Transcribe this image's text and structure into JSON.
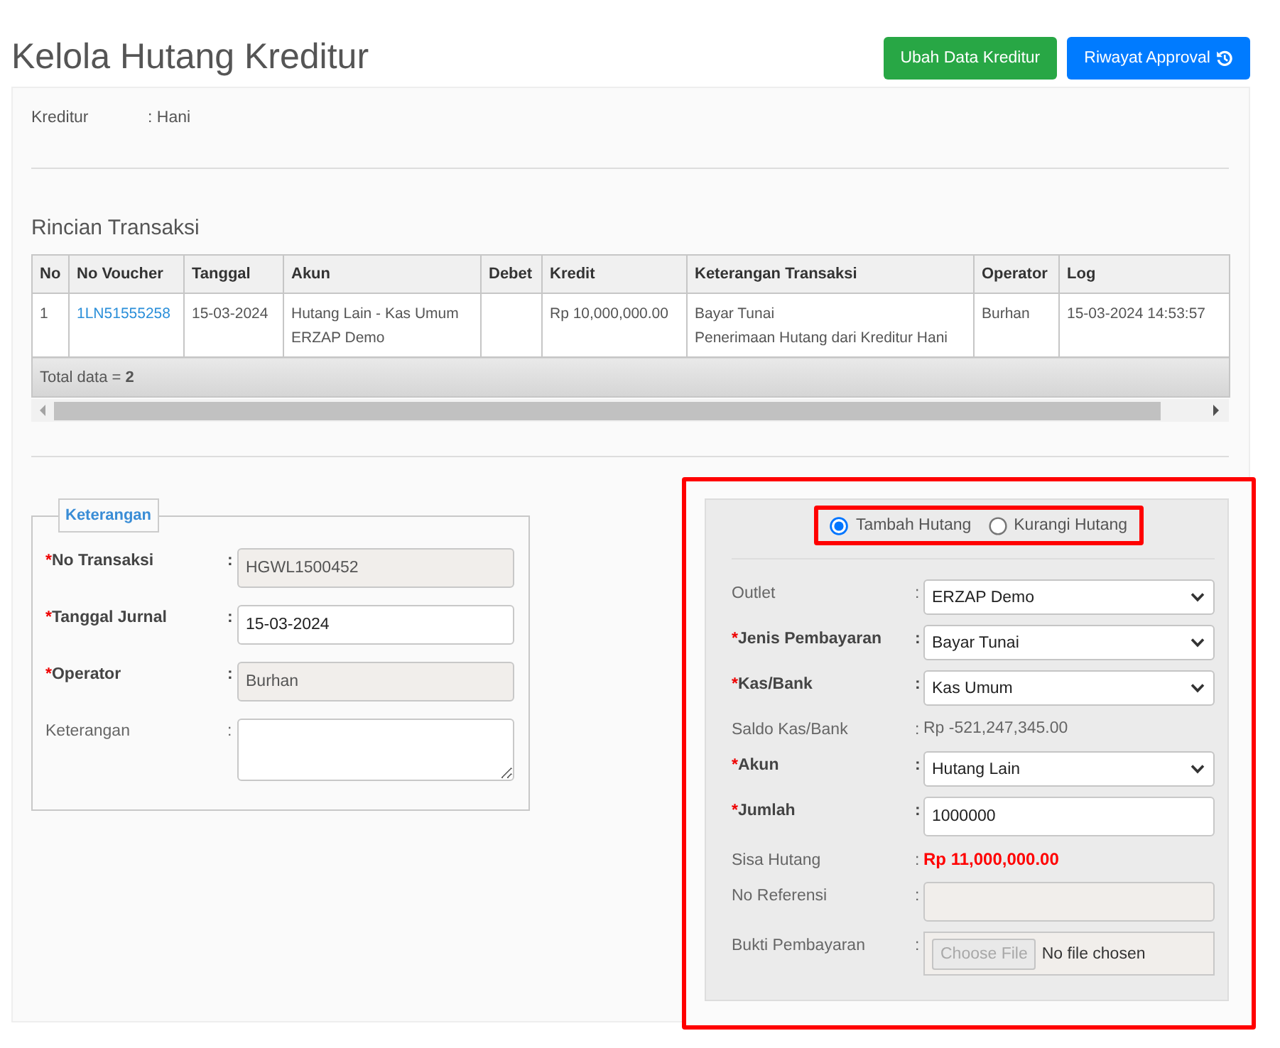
{
  "page": {
    "title": "Kelola Hutang Kreditur",
    "actions": [
      {
        "label": "Ubah Data Kreditur",
        "kind": "success",
        "icon": false
      },
      {
        "label": "Riwayat Approval",
        "kind": "primary",
        "icon": true
      }
    ]
  },
  "creditor": {
    "label": "Kreditur",
    "value": ": Hani"
  },
  "transactions": {
    "title": "Rincian Transaksi",
    "columns": [
      "No",
      "No Voucher",
      "Tanggal",
      "Akun",
      "Debet",
      "Kredit",
      "Keterangan Transaksi",
      "Operator",
      "Log"
    ],
    "rows": [
      {
        "cells": [
          {
            "kind": "text",
            "lines": [
              "1"
            ]
          },
          {
            "kind": "link",
            "lines": [
              "1LN51555258"
            ]
          },
          {
            "kind": "text",
            "lines": [
              "15-03-2024"
            ]
          },
          {
            "kind": "text",
            "lines": [
              "Hutang Lain - Kas Umum",
              "ERZAP Demo"
            ]
          },
          null,
          {
            "kind": "text",
            "lines": [
              "Rp 10,000,000.00"
            ]
          },
          {
            "kind": "text",
            "lines": [
              "Bayar Tunai",
              "Penerimaan Hutang dari Kreditur Hani"
            ]
          },
          {
            "kind": "text",
            "lines": [
              "Burhan"
            ]
          },
          {
            "kind": "text",
            "lines": [
              "15-03-2024 14:53:57"
            ]
          }
        ]
      }
    ],
    "total": "Total data =  **2**"
  },
  "details": {
    "legend": "Keterangan",
    "fields": [
      {
        "kind": "input",
        "label": "No Transaksi",
        "marker": "*",
        "required": true,
        "separator": ":",
        "value": "HGWL1500452",
        "readonly": true
      },
      {
        "kind": "input",
        "label": "Tanggal Jurnal",
        "marker": "*",
        "required": true,
        "separator": ":",
        "value": "15-03-2024",
        "readonly": false
      },
      {
        "kind": "input",
        "label": "Operator",
        "marker": "*",
        "required": true,
        "separator": ":",
        "value": "Burhan",
        "readonly": true
      },
      {
        "kind": "textarea",
        "label": "Keterangan",
        "required": false,
        "separator": ":",
        "readonly": false
      }
    ]
  },
  "payment": {
    "highlighted": true,
    "mode": {
      "highlighted": true,
      "options": [
        {
          "label": "Tambah Hutang",
          "selected": true
        },
        {
          "label": "Kurangi Hutang",
          "selected": false
        }
      ]
    },
    "fields": [
      {
        "kind": "select",
        "label": "Outlet",
        "required": false,
        "separator": ":",
        "value": "ERZAP Demo"
      },
      {
        "kind": "select",
        "label": "Jenis Pembayaran",
        "marker": "*",
        "required": true,
        "separator": ":",
        "value": "Bayar Tunai"
      },
      {
        "kind": "select",
        "label": "Kas/Bank",
        "marker": "*",
        "required": true,
        "separator": ":",
        "value": "Kas Umum"
      },
      {
        "kind": "text",
        "label": "Saldo Kas/Bank",
        "required": false,
        "separator": ":",
        "value": "Rp -521,247,345.00",
        "alert": false
      },
      {
        "kind": "select",
        "label": "Akun",
        "marker": "*",
        "required": true,
        "separator": ":",
        "value": "Hutang Lain"
      },
      {
        "kind": "input",
        "label": "Jumlah",
        "marker": "*",
        "required": true,
        "separator": ":",
        "value": "1000000",
        "readonly": false
      },
      {
        "kind": "text",
        "label": "Sisa Hutang",
        "required": false,
        "separator": ":",
        "value": "Rp 11,000,000.00",
        "alert": true
      },
      {
        "kind": "input",
        "label": "No Referensi",
        "required": false,
        "separator": ":",
        "readonly": true
      },
      {
        "kind": "file",
        "label": "Bukti Pembayaran",
        "required": false,
        "separator": ":",
        "button": "Choose File",
        "status": "No file chosen"
      }
    ]
  }
}
